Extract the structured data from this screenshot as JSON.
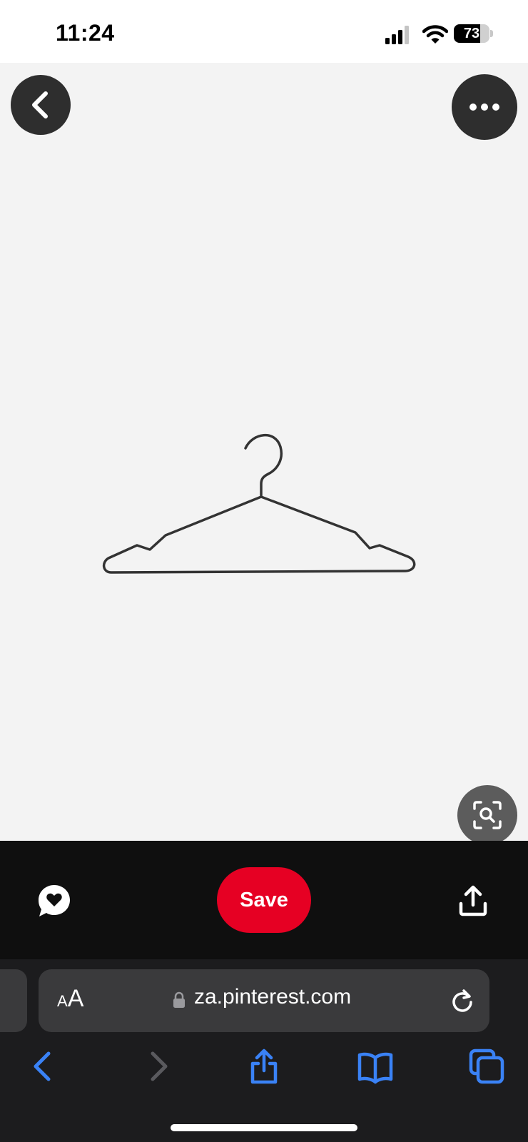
{
  "status_bar": {
    "time": "11:24",
    "battery_level": 73,
    "battery_text": "73"
  },
  "pin": {
    "image_subject": "hanger-icon"
  },
  "actions": {
    "save_label": "Save",
    "save_color": "#e60023"
  },
  "browser": {
    "text_size_label_small": "A",
    "text_size_label_large": "A",
    "url": "za.pinterest.com",
    "accent_color": "#3a82f6"
  },
  "icons": {
    "back": "chevron-left-icon",
    "more": "ellipsis-icon",
    "visual_search": "visual-search-icon",
    "comment": "speech-bubble-heart-icon",
    "share": "share-upload-icon",
    "lock": "lock-icon",
    "reload": "reload-icon",
    "toolbar": [
      "back-arrow-icon",
      "forward-arrow-icon",
      "share-icon",
      "bookmarks-icon",
      "tabs-icon"
    ]
  }
}
